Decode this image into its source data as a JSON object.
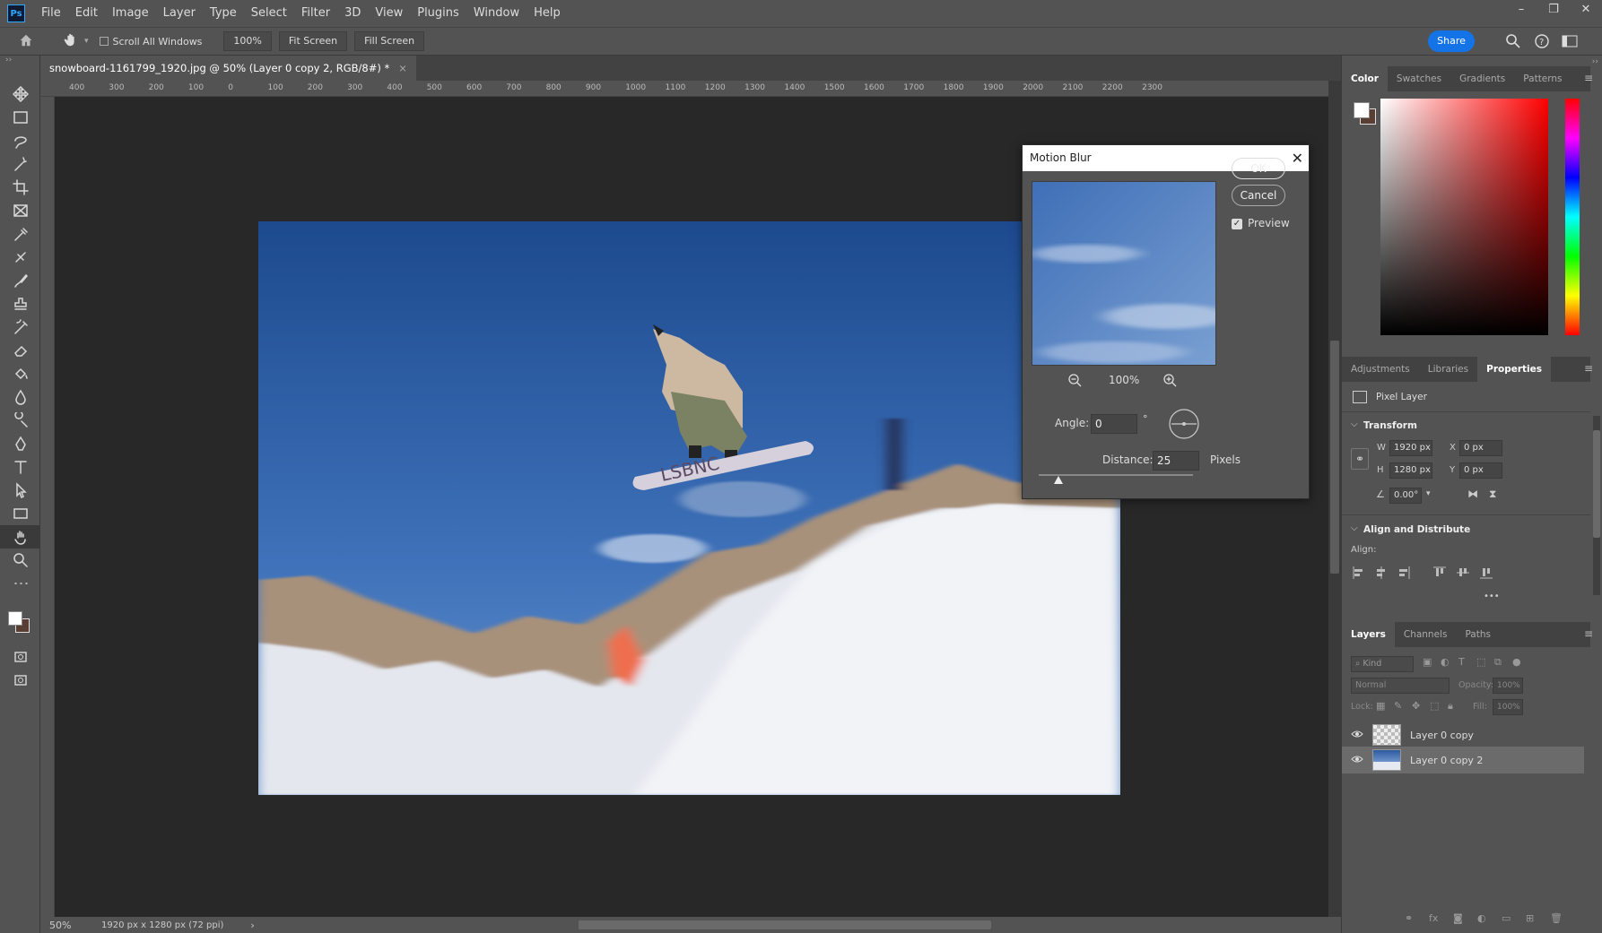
{
  "app": {
    "logo": "Ps"
  },
  "menu": [
    "File",
    "Edit",
    "Image",
    "Layer",
    "Type",
    "Select",
    "Filter",
    "3D",
    "View",
    "Plugins",
    "Window",
    "Help"
  ],
  "window_controls": [
    "–",
    "❐",
    "✕"
  ],
  "options": {
    "scroll_all": "Scroll All Windows",
    "zoom": "100%",
    "fit_screen": "Fit Screen",
    "fill_screen": "Fill Screen",
    "share": "Share"
  },
  "document_tab": {
    "title": "snowboard-1161799_1920.jpg @ 50% (Layer 0 copy 2, RGB/8#) *",
    "close": "×"
  },
  "ruler_h": [
    "400",
    "300",
    "200",
    "100",
    "0",
    "100",
    "200",
    "300",
    "400",
    "500",
    "600",
    "700",
    "800",
    "900",
    "1000",
    "1100",
    "1200",
    "1300",
    "1400",
    "1500",
    "1600",
    "1700",
    "1800",
    "1900",
    "2000",
    "2100",
    "2200",
    "2300"
  ],
  "status": {
    "zoom": "50%",
    "doc_info": "1920 px x 1280 px (72 ppi)",
    "arrow": "›"
  },
  "dialog": {
    "title": "Motion Blur",
    "ok": "OK",
    "cancel": "Cancel",
    "preview_label": "Preview",
    "preview_checked": true,
    "zoom": "100%",
    "angle_label": "Angle:",
    "angle_value": "0",
    "angle_unit": "°",
    "distance_label": "Distance:",
    "distance_value": "25",
    "distance_unit": "Pixels",
    "distance_fraction": 0.13
  },
  "color_panel": {
    "tabs": [
      "Color",
      "Swatches",
      "Gradients",
      "Patterns"
    ],
    "active": "Color",
    "hue": "#ff0000"
  },
  "properties_panel": {
    "tabs": [
      "Adjustments",
      "Libraries",
      "Properties"
    ],
    "active": "Properties",
    "layer_type": "Pixel Layer",
    "transform_title": "Transform",
    "w_label": "W",
    "w_value": "1920 px",
    "h_label": "H",
    "h_value": "1280 px",
    "x_label": "X",
    "x_value": "0 px",
    "y_label": "Y",
    "y_value": "0 px",
    "angle_value": "0.00°",
    "align_title": "Align and Distribute",
    "align_label": "Align:",
    "more": "•••"
  },
  "layers_panel": {
    "tabs": [
      "Layers",
      "Channels",
      "Paths"
    ],
    "active": "Layers",
    "kind": "Kind",
    "blend": "Normal",
    "opacity_label": "Opacity:",
    "opacity_value": "100%",
    "lock_label": "Lock:",
    "fill_label": "Fill:",
    "fill_value": "100%",
    "layers": [
      {
        "name": "Layer 0 copy",
        "visible": true,
        "selected": false
      },
      {
        "name": "Layer 0 copy 2",
        "visible": true,
        "selected": true
      }
    ]
  }
}
